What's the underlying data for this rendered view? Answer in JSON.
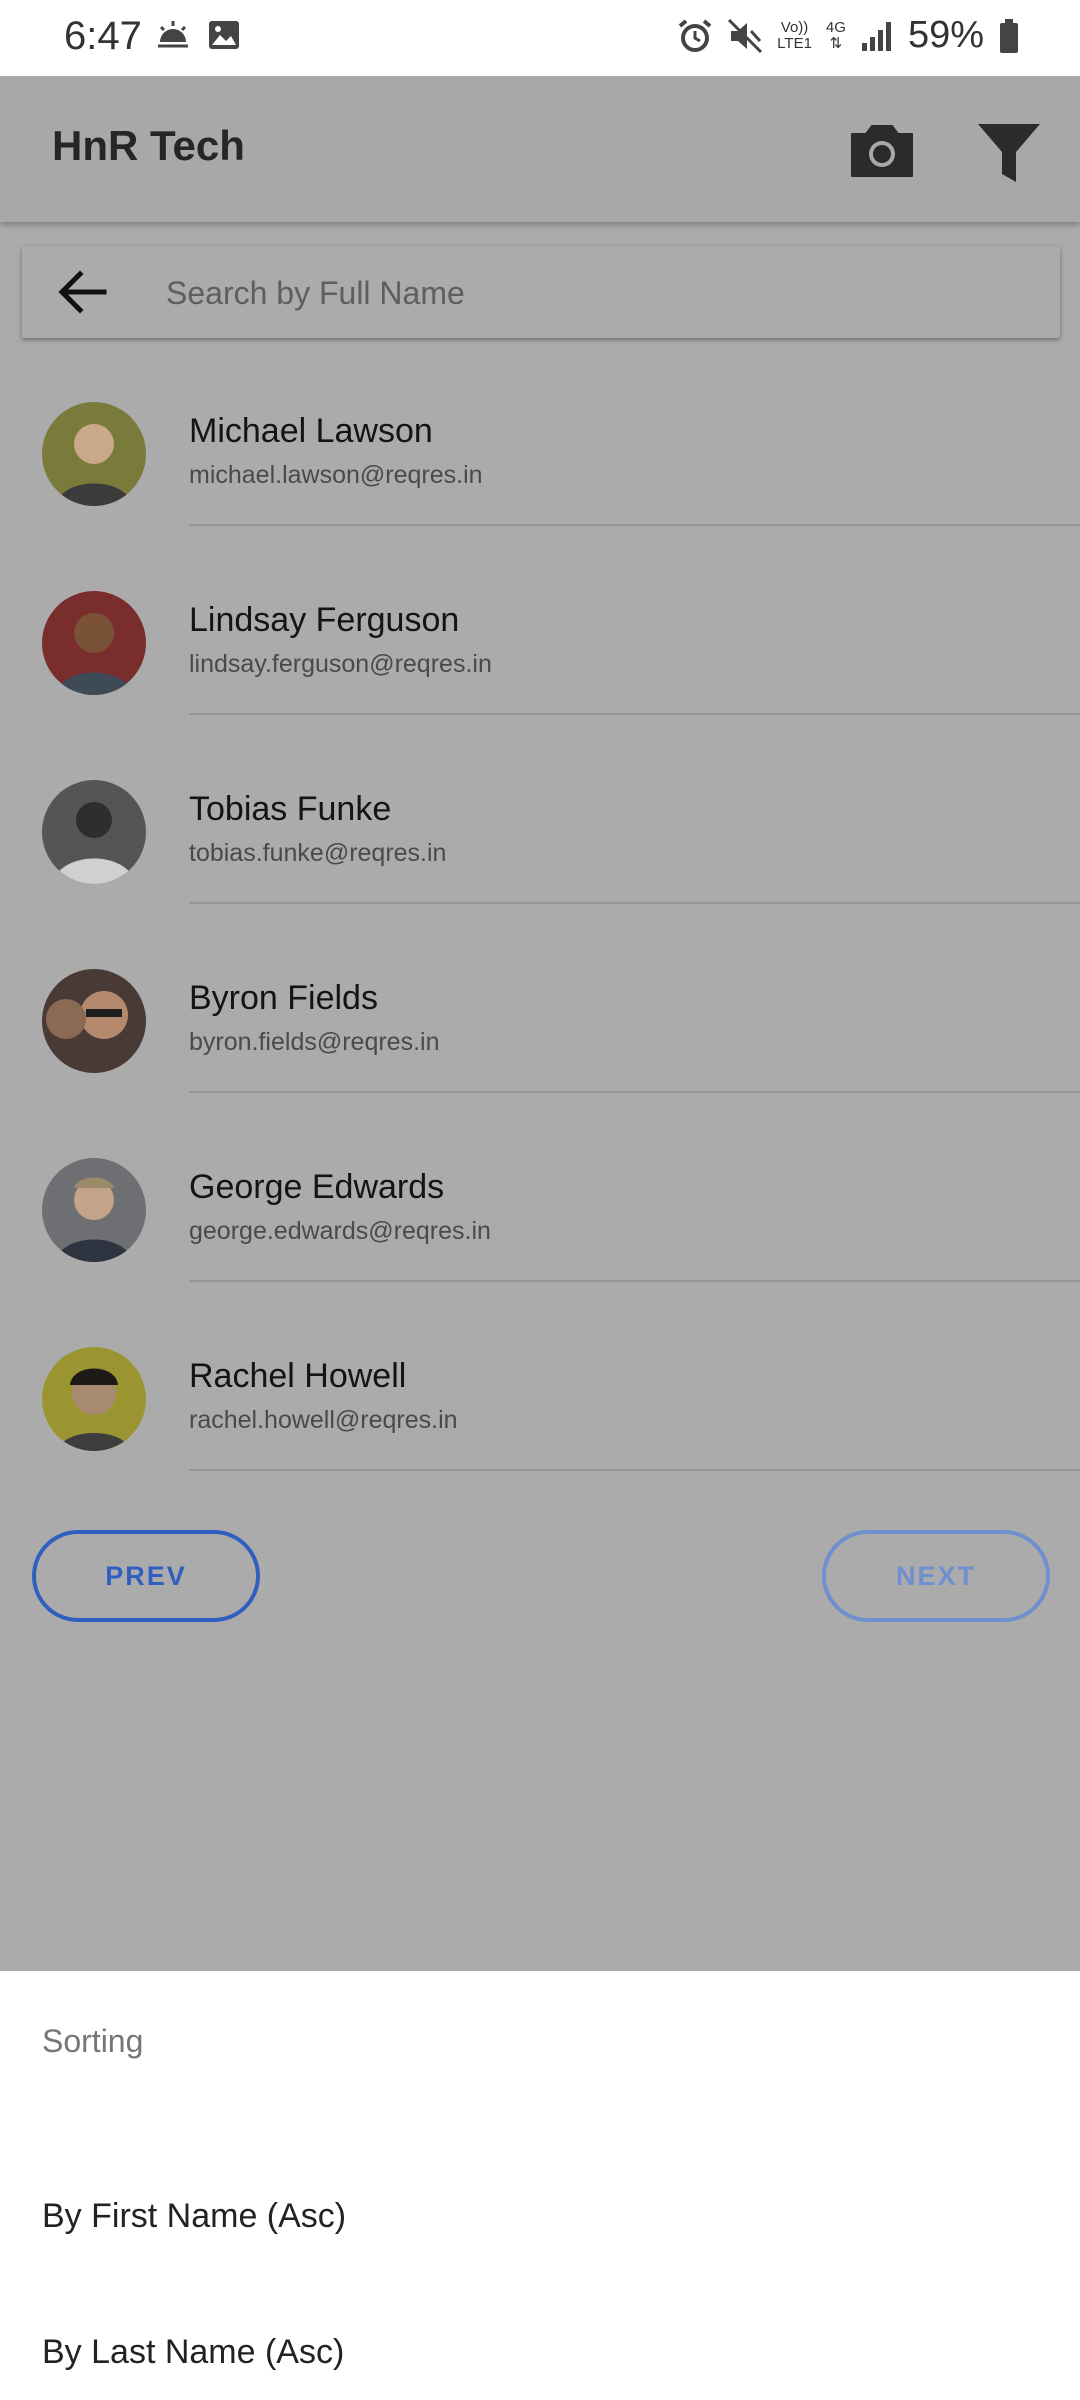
{
  "status_bar": {
    "time": "6:47",
    "left_icons": [
      "weather-icon",
      "image-icon"
    ],
    "network_lines": [
      "Vo))",
      "LTE1"
    ],
    "network_type": "4G",
    "battery_percent": "59%",
    "right_icons": [
      "alarm-icon",
      "mute-icon",
      "signal-icon",
      "battery-icon"
    ]
  },
  "app_bar": {
    "title": "HnR Tech",
    "actions": [
      "camera-icon",
      "filter-icon"
    ]
  },
  "search": {
    "placeholder": "Search by Full Name",
    "value": ""
  },
  "users": [
    {
      "name": "Michael Lawson",
      "email": "michael.lawson@reqres.in",
      "avatar_color": "#7a7a3a"
    },
    {
      "name": "Lindsay Ferguson",
      "email": "lindsay.ferguson@reqres.in",
      "avatar_color": "#7a2d2d"
    },
    {
      "name": "Tobias Funke",
      "email": "tobias.funke@reqres.in",
      "avatar_color": "#555555"
    },
    {
      "name": "Byron Fields",
      "email": "byron.fields@reqres.in",
      "avatar_color": "#4a3a36"
    },
    {
      "name": "George Edwards",
      "email": "george.edwards@reqres.in",
      "avatar_color": "#6e6f73"
    },
    {
      "name": "Rachel Howell",
      "email": "rachel.howell@reqres.in",
      "avatar_color": "#9a9530"
    }
  ],
  "pagination": {
    "prev_label": "PREV",
    "next_label": "NEXT"
  },
  "sort_sheet": {
    "title": "Sorting",
    "options": [
      "By First Name (Asc)",
      "By Last Name (Asc)"
    ]
  },
  "colors": {
    "accent": "#2f5fc0",
    "scrim": "#ababab",
    "sheet_background": "#ffffff"
  }
}
